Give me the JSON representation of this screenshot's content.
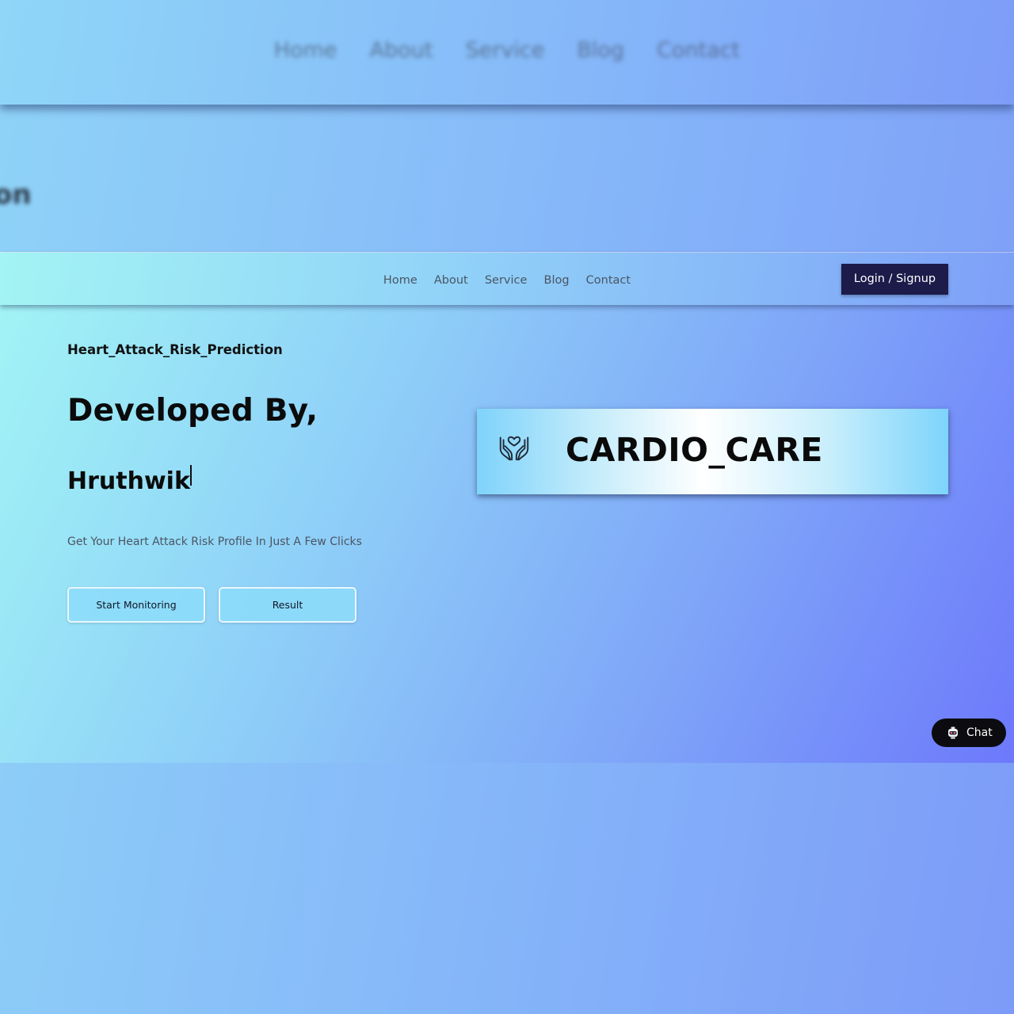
{
  "background": {
    "nav_links": [
      "Home",
      "About",
      "Service",
      "Blog",
      "Contact"
    ],
    "heading_fragment": "on"
  },
  "header": {
    "nav_links": [
      "Home",
      "About",
      "Service",
      "Blog",
      "Contact"
    ],
    "login_label": "Login / Signup"
  },
  "hero": {
    "subtitle": "Heart_Attack_Risk_Prediction",
    "developed_by": "Developed By,",
    "author": "Hruthwik",
    "tagline": "Get Your Heart Attack Risk Profile In Just A Few Clicks",
    "start_label": "Start Monitoring",
    "result_label": "Result"
  },
  "brand": {
    "name": "CARDIO_CARE",
    "icon": "heart-hands-icon"
  },
  "chat": {
    "label": "Chat",
    "icon": "robot-icon"
  },
  "colors": {
    "login_button": "#1d1b4a",
    "chat_button": "#0c0c10",
    "gradient_start": "#a2f6f5",
    "gradient_end": "#6d79fb"
  }
}
